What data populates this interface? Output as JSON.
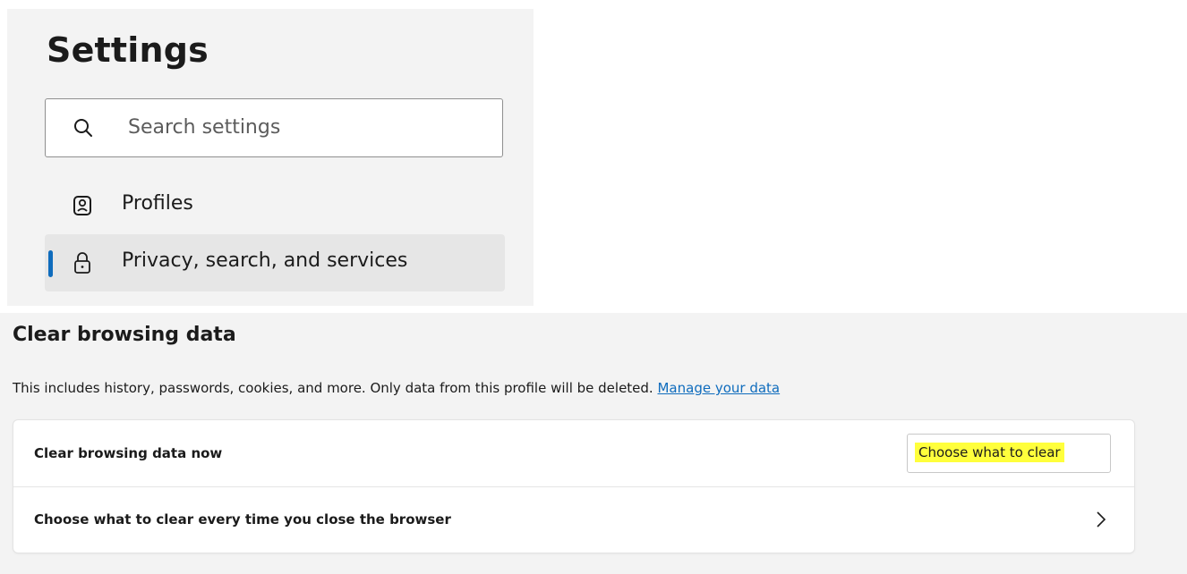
{
  "sidebar": {
    "title": "Settings",
    "search": {
      "placeholder": "Search settings",
      "icon": "search-icon"
    },
    "items": [
      {
        "label": "Profiles",
        "icon": "profile-icon",
        "selected": false
      },
      {
        "label": "Privacy, search, and services",
        "icon": "lock-icon",
        "selected": true
      }
    ]
  },
  "clear_data": {
    "title": "Clear browsing data",
    "description": "This includes history, passwords, cookies, and more. Only data from this profile will be deleted.",
    "manage_link": "Manage your data",
    "rows": [
      {
        "label": "Clear browsing data now",
        "button_label": "Choose what to clear"
      },
      {
        "label": "Choose what to clear every time you close the browser",
        "icon": "chevron-right-icon"
      }
    ]
  },
  "colors": {
    "accent": "#0f6cbd",
    "highlight": "#ffff3c",
    "panel_background": "#f3f3f3",
    "selected_item_background": "#e6e6e6"
  }
}
